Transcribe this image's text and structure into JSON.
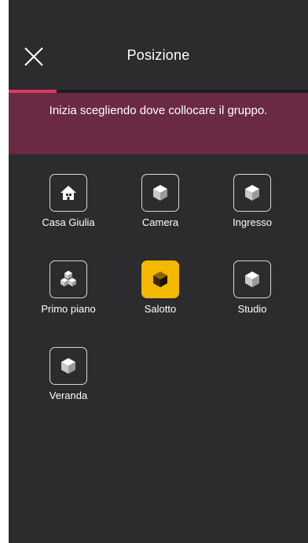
{
  "header": {
    "title": "Posizione"
  },
  "progress": {
    "fraction": 0.16
  },
  "banner": {
    "text": "Inizia scegliendo dove collocare il gruppo."
  },
  "rooms": [
    {
      "label": "Casa Giulia",
      "icon": "house-icon",
      "selected": false
    },
    {
      "label": "Camera",
      "icon": "cube-icon",
      "selected": false
    },
    {
      "label": "Ingresso",
      "icon": "cube-icon",
      "selected": false
    },
    {
      "label": "Primo piano",
      "icon": "cubes-stack-icon",
      "selected": false
    },
    {
      "label": "Salotto",
      "icon": "cube-icon",
      "selected": true
    },
    {
      "label": "Studio",
      "icon": "cube-icon",
      "selected": false
    },
    {
      "label": "Veranda",
      "icon": "cube-icon",
      "selected": false
    }
  ],
  "colors": {
    "background": "#2c2c2e",
    "accent": "#e0385f",
    "banner": "#6b2a43",
    "selected": "#f5b800"
  }
}
